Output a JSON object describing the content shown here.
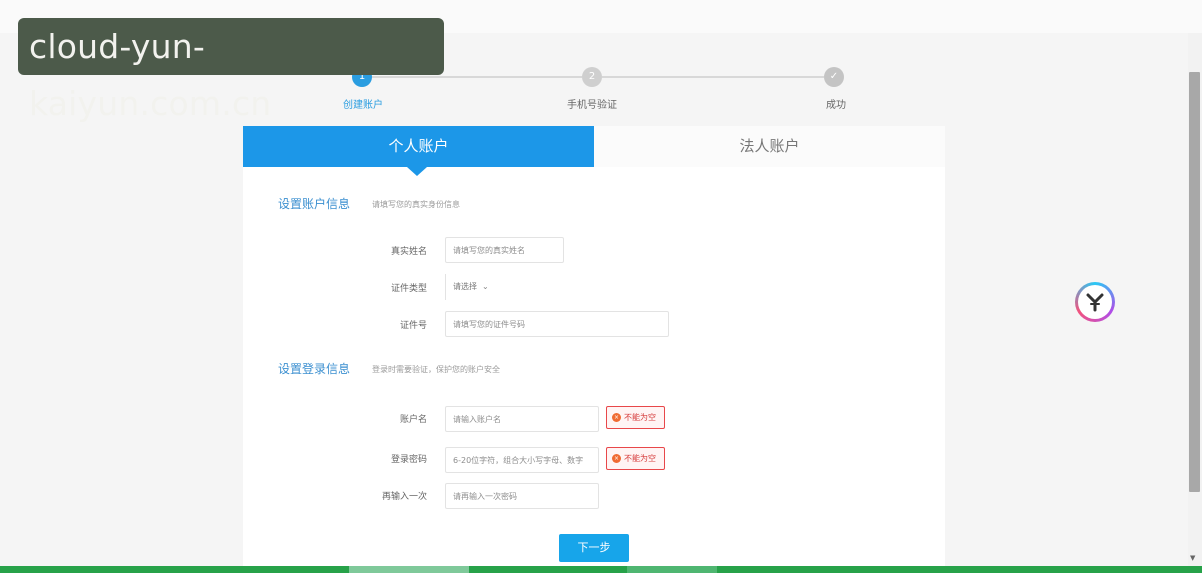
{
  "watermark": {
    "text": "cloud-yun-kaiyun.com.cn"
  },
  "stepper": {
    "steps": [
      {
        "number": "1",
        "label": "创建账户"
      },
      {
        "number": "2",
        "label": "手机号验证"
      },
      {
        "number": "✓",
        "label": "成功"
      }
    ]
  },
  "tabs": {
    "personal": "个人账户",
    "corporate": "法人账户"
  },
  "account_info": {
    "title": "设置账户信息",
    "hint": "请填写您的真实身份信息",
    "real_name": {
      "label": "真实姓名",
      "placeholder": "请填写您的真实姓名"
    },
    "id_type": {
      "label": "证件类型",
      "value": "请选择"
    },
    "id_number": {
      "label": "证件号",
      "placeholder": "请填写您的证件号码"
    }
  },
  "login_info": {
    "title": "设置登录信息",
    "hint": "登录时需要验证，保护您的账户安全",
    "username": {
      "label": "账户名",
      "placeholder": "请输入账户名",
      "error": "不能为空"
    },
    "password": {
      "label": "登录密码",
      "placeholder": "6-20位字符，组合大小写字母、数字",
      "error": "不能为空"
    },
    "confirm": {
      "label": "再输入一次",
      "placeholder": "请再输入一次密码"
    }
  },
  "next_button": "下一步",
  "colors": {
    "primary": "#1c97e8",
    "error": "#e8474a",
    "taskbar": "#27a249"
  }
}
